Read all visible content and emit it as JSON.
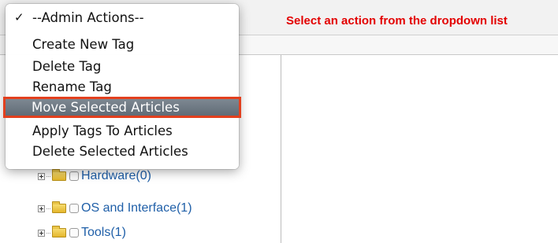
{
  "header": {
    "instruction": "Select an action from the dropdown list"
  },
  "menu": {
    "check_glyph": "✓",
    "items": [
      {
        "label": "--Admin Actions--",
        "checked": true
      },
      {
        "label": "Create New Tag"
      },
      {
        "label": "Delete Tag"
      },
      {
        "label": "Rename Tag"
      },
      {
        "label": "Move Selected Articles",
        "selected": true
      },
      {
        "label": "Apply Tags To Articles"
      },
      {
        "label": "Delete Selected Articles"
      }
    ]
  },
  "tree": {
    "items": [
      {
        "label": "Hardware(0)"
      },
      {
        "label": "OS and Interface(1)"
      },
      {
        "label": "Tools(1)"
      }
    ]
  },
  "colors": {
    "instruction": "#e30000",
    "link": "#1f5fa8",
    "highlight_border": "#e3401e",
    "selected_bg": "#6b757f"
  }
}
